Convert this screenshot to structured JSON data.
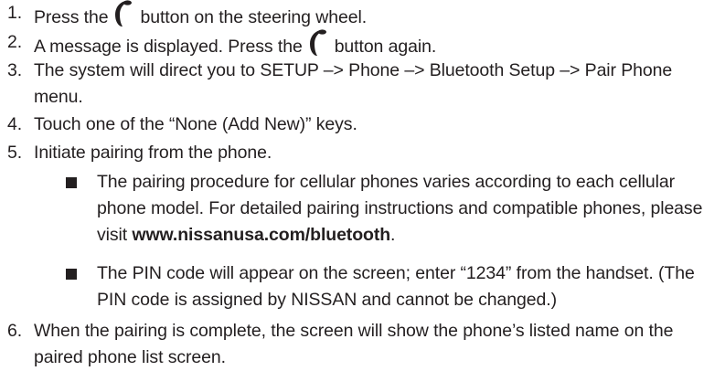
{
  "steps": [
    {
      "num": "1.",
      "before": "Press the",
      "after": "button on the steering wheel."
    },
    {
      "num": "2.",
      "before": "A message is displayed. Press the",
      "after": "button again."
    },
    {
      "num": "3.",
      "text": "The system will direct you to SETUP –> Phone –> Bluetooth Setup –> Pair Phone menu."
    },
    {
      "num": "4.",
      "text": "Touch one of the “None (Add New)” keys."
    },
    {
      "num": "5.",
      "text": "Initiate pairing from the phone."
    },
    {
      "num": "6.",
      "text": "When the pairing is complete, the screen will show the phone’s listed name on the paired phone list screen."
    }
  ],
  "bullets": [
    {
      "text": "The pairing procedure for cellular phones varies according to each cellular phone model. For detailed pairing instructions and compatible phones, please visit",
      "link": "www.nissanusa.com/bluetooth",
      "after": "."
    },
    {
      "text": "The PIN code will appear on the screen; enter “1234” from the handset. (The PIN code is assigned by NISSAN and cannot be changed.)"
    }
  ],
  "icons": {
    "phone": "phone-handset-icon"
  }
}
